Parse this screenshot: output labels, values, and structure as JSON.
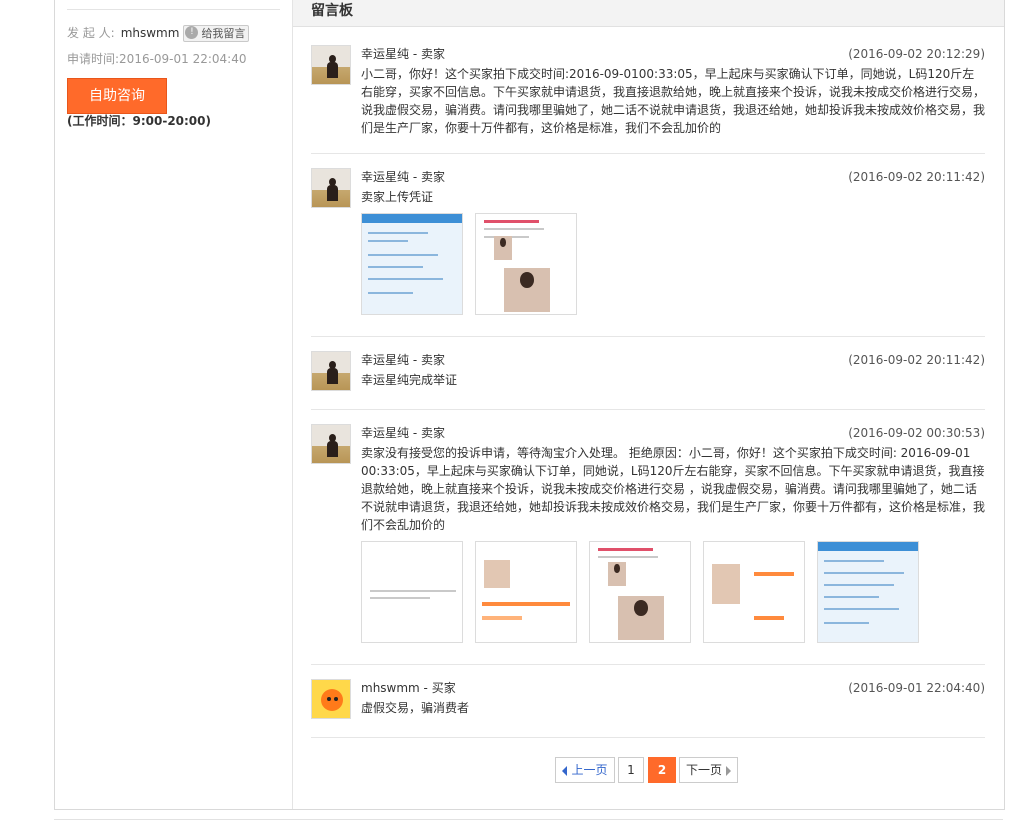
{
  "sidebar": {
    "initiator_label": "发 起 人:",
    "initiator_name": "mhswmm",
    "leave_message_label": "给我留言",
    "apply_time_label": "申请时间:",
    "apply_time": "2016-09-01 22:04:40",
    "consult_button": "自助咨询",
    "working_hours": "(工作时间：9:00-20:00)"
  },
  "board": {
    "title": "留言板",
    "messages": [
      {
        "author": "幸运星纯 - 卖家",
        "time": "(2016-09-02 20:12:29)",
        "text": "小二哥，你好！这个买家拍下成交时间:2016-09-0100:33:05，早上起床与买家确认下订单，同她说，L码120斤左右能穿，买家不回信息。下午买家就申请退货，我直接退款给她，晚上就直接来个投诉，说我未按成交价格进行交易，说我虚假交易，骗消费。请问我哪里骗她了，她二话不说就申请退货，我退还给她，她却投诉我未按成效价格交易，我们是生产厂家，你要十万件都有，这价格是标准，我们不会乱加价的"
      },
      {
        "author": "幸运星纯 - 卖家",
        "time": "(2016-09-02 20:11:42)",
        "text": "卖家上传凭证"
      },
      {
        "author": "幸运星纯 - 卖家",
        "time": "(2016-09-02 20:11:42)",
        "text": "幸运星纯完成举证"
      },
      {
        "author": "幸运星纯 - 卖家",
        "time": "(2016-09-02 00:30:53)",
        "text": "卖家没有接受您的投诉申请，等待淘宝介入处理。 拒绝原因：小二哥，你好！这个买家拍下成交时间: 2016-09-01 00:33:05，早上起床与买家确认下订单，同她说，L码120斤左右能穿，买家不回信息。下午买家就申请退货，我直接退款给她，晚上就直接来个投诉，说我未按成交价格进行交易 ，说我虚假交易，骗消费。请问我哪里骗她了，她二话不说就申请退货，我退还给她，她却投诉我未按成效价格交易，我们是生产厂家，你要十万件都有，这价格是标准，我们不会乱加价的"
      },
      {
        "author": "mhswmm - 买家",
        "time": "(2016-09-01 22:04:40)",
        "text": "虚假交易，骗消费者"
      }
    ]
  },
  "pagination": {
    "prev": "上一页",
    "page1": "1",
    "page2": "2",
    "next": "下一页"
  },
  "colors": {
    "accent": "#ff6a2a",
    "link": "#3366cc"
  }
}
